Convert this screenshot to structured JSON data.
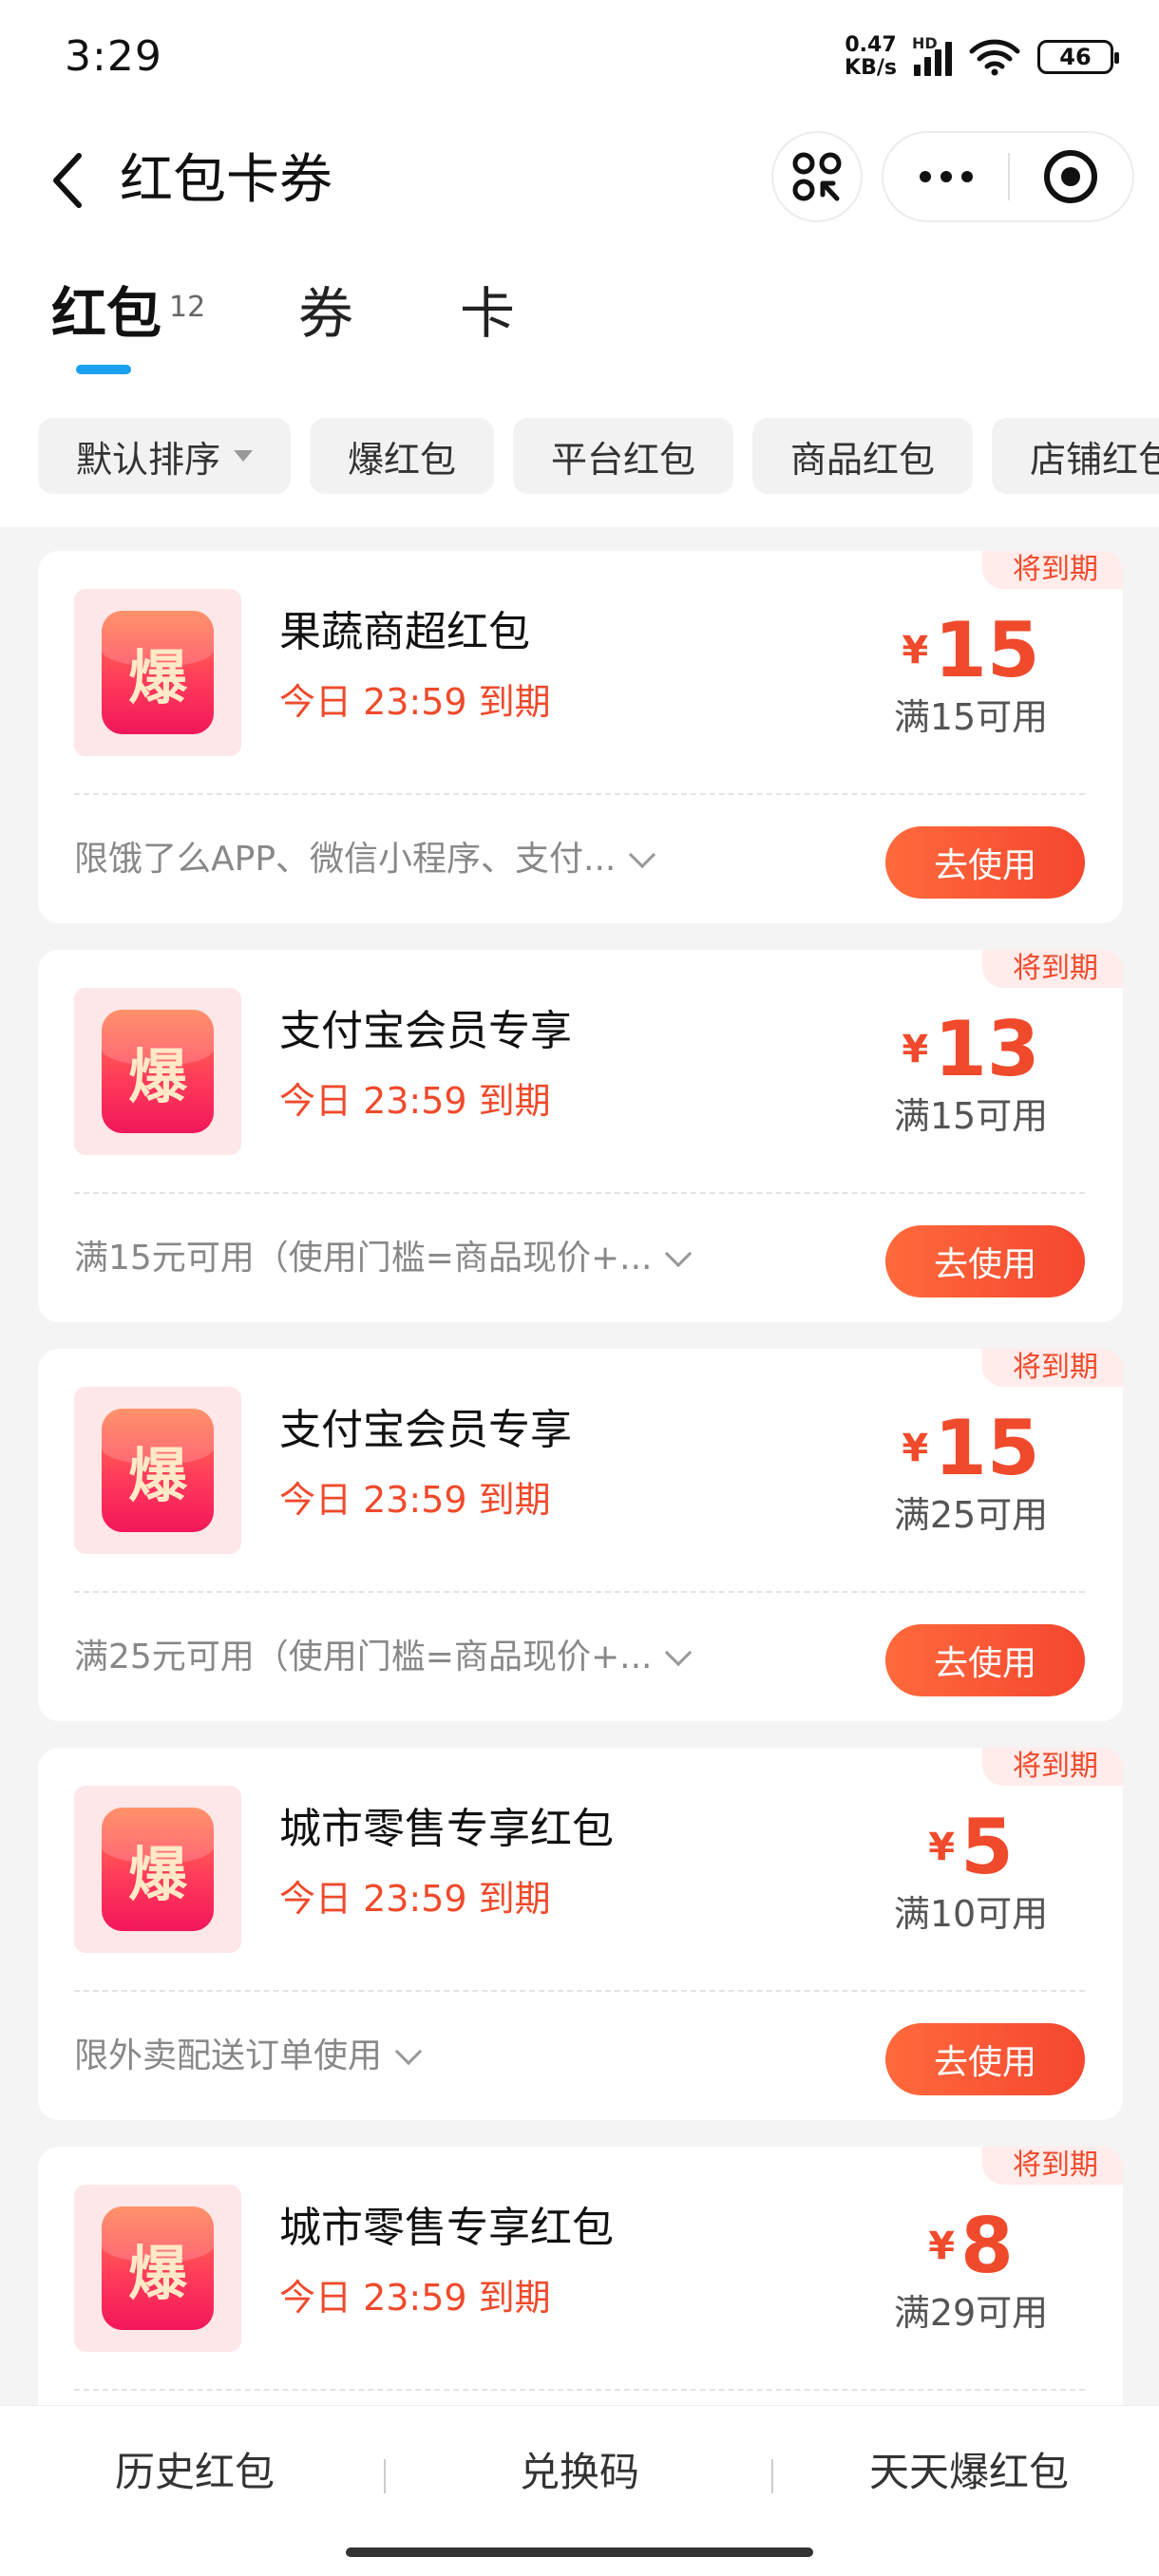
{
  "status_bar": {
    "time": "3:29",
    "net_speed_value": "0.47",
    "net_speed_unit": "KB/s",
    "signal_label": "HD",
    "battery": "46"
  },
  "nav": {
    "title": "红包卡券"
  },
  "tabs": [
    {
      "label": "红包",
      "count": "12",
      "active": true
    },
    {
      "label": "券",
      "active": false
    },
    {
      "label": "卡",
      "active": false
    }
  ],
  "filters": [
    {
      "label": "默认排序",
      "has_dropdown": true
    },
    {
      "label": "爆红包"
    },
    {
      "label": "平台红包"
    },
    {
      "label": "商品红包"
    },
    {
      "label": "店铺红包"
    }
  ],
  "cards": [
    {
      "tag": "将到期",
      "logo_char": "爆",
      "title": "果蔬商超红包",
      "expire": "今日 23:59 到期",
      "currency": "¥",
      "amount": "15",
      "threshold": "满15可用",
      "rule": "限饿了么APP、微信小程序、支付...",
      "button": "去使用"
    },
    {
      "tag": "将到期",
      "logo_char": "爆",
      "title": "支付宝会员专享",
      "expire": "今日 23:59 到期",
      "currency": "¥",
      "amount": "13",
      "threshold": "满15可用",
      "rule": "满15元可用（使用门槛=商品现价+...",
      "button": "去使用"
    },
    {
      "tag": "将到期",
      "logo_char": "爆",
      "title": "支付宝会员专享",
      "expire": "今日 23:59 到期",
      "currency": "¥",
      "amount": "15",
      "threshold": "满25可用",
      "rule": "满25元可用（使用门槛=商品现价+...",
      "button": "去使用"
    },
    {
      "tag": "将到期",
      "logo_char": "爆",
      "title": "城市零售专享红包",
      "expire": "今日 23:59 到期",
      "currency": "¥",
      "amount": "5",
      "threshold": "满10可用",
      "rule": "限外卖配送订单使用",
      "button": "去使用"
    },
    {
      "tag": "将到期",
      "logo_char": "爆",
      "title": "城市零售专享红包",
      "expire": "今日 23:59 到期",
      "currency": "¥",
      "amount": "8",
      "threshold": "满29可用",
      "rule": "",
      "button": ""
    }
  ],
  "bottom_bar": {
    "items": [
      "历史红包",
      "兑换码",
      "天天爆红包"
    ]
  },
  "colors": {
    "accent": "#ef4a2b",
    "tab_indicator": "#1aa0ee",
    "button_gradient_start": "#ff6a3c",
    "button_gradient_end": "#f4472f"
  }
}
